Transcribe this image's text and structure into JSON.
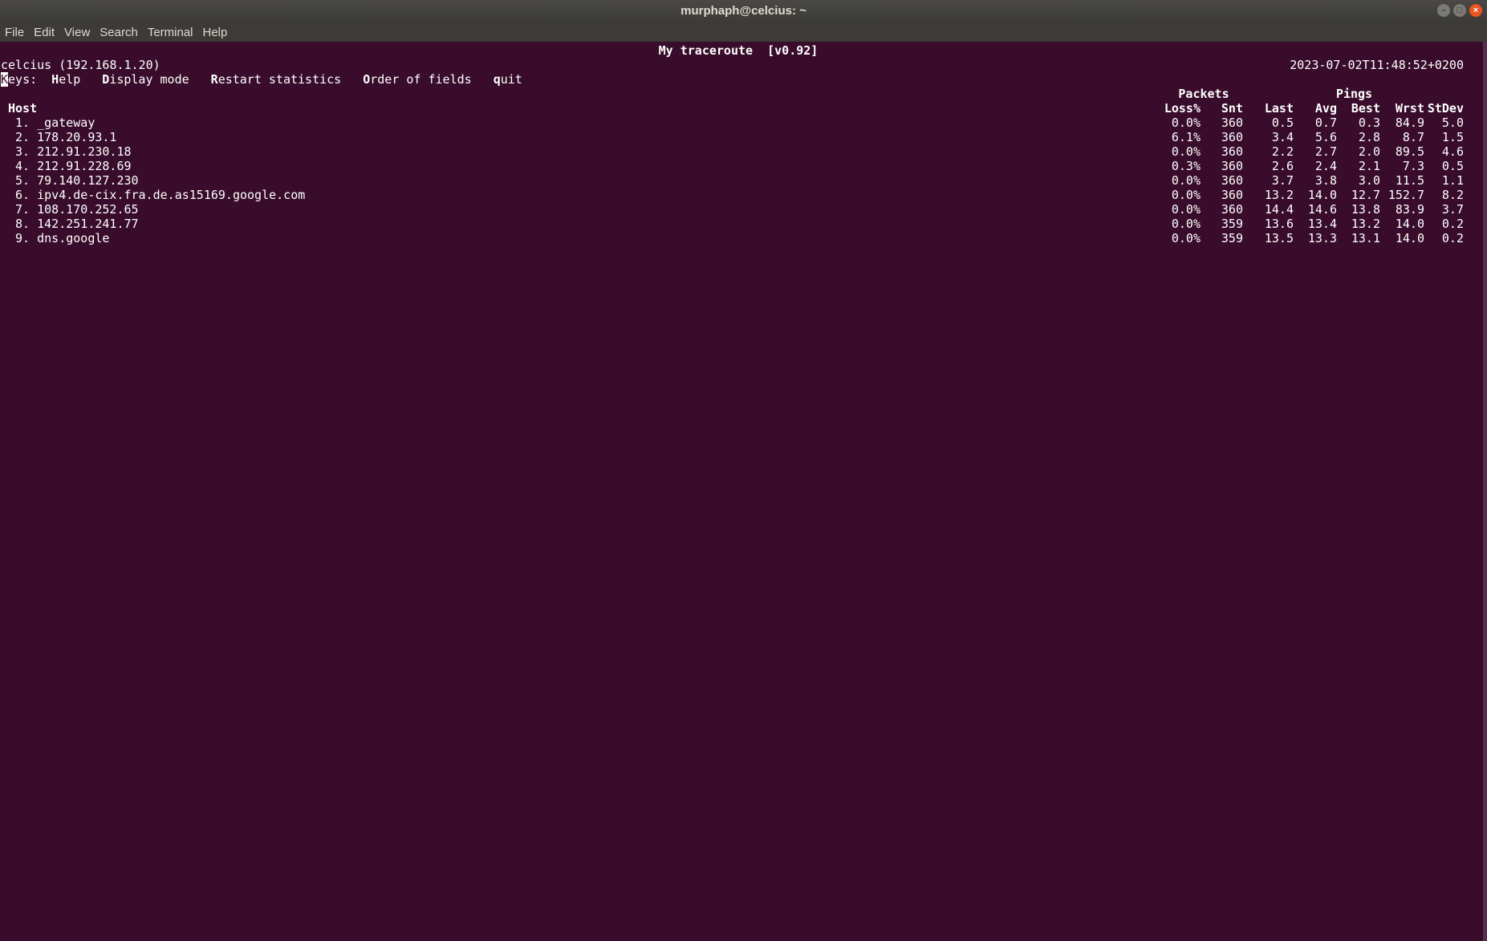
{
  "window": {
    "title": "murphaph@celcius: ~"
  },
  "menubar": {
    "items": [
      "File",
      "Edit",
      "View",
      "Search",
      "Terminal",
      "Help"
    ]
  },
  "mtr": {
    "title": "My traceroute  [v0.92]",
    "host_line": "celcius (192.168.1.20)",
    "timestamp": "2023-07-02T11:48:52+0200",
    "keys_cursor": "K",
    "keys_label_rest": "eys:",
    "keys": [
      {
        "hot": "H",
        "rest": "elp"
      },
      {
        "hot": "D",
        "rest": "isplay mode"
      },
      {
        "hot": "R",
        "rest": "estart statistics"
      },
      {
        "hot": "O",
        "rest": "rder of fields"
      },
      {
        "hot": "q",
        "rest": "uit"
      }
    ],
    "group_packets": "Packets",
    "group_pings": "Pings",
    "columns": {
      "host": "Host",
      "loss": "Loss%",
      "snt": "Snt",
      "last": "Last",
      "avg": "Avg",
      "best": "Best",
      "wrst": "Wrst",
      "stdev": "StDev"
    },
    "rows": [
      {
        "host": " 1. _gateway",
        "loss": "0.0%",
        "snt": "360",
        "last": "0.5",
        "avg": "0.7",
        "best": "0.3",
        "wrst": "84.9",
        "stdev": "5.0"
      },
      {
        "host": " 2. 178.20.93.1",
        "loss": "6.1%",
        "snt": "360",
        "last": "3.4",
        "avg": "5.6",
        "best": "2.8",
        "wrst": "8.7",
        "stdev": "1.5"
      },
      {
        "host": " 3. 212.91.230.18",
        "loss": "0.0%",
        "snt": "360",
        "last": "2.2",
        "avg": "2.7",
        "best": "2.0",
        "wrst": "89.5",
        "stdev": "4.6"
      },
      {
        "host": " 4. 212.91.228.69",
        "loss": "0.3%",
        "snt": "360",
        "last": "2.6",
        "avg": "2.4",
        "best": "2.1",
        "wrst": "7.3",
        "stdev": "0.5"
      },
      {
        "host": " 5. 79.140.127.230",
        "loss": "0.0%",
        "snt": "360",
        "last": "3.7",
        "avg": "3.8",
        "best": "3.0",
        "wrst": "11.5",
        "stdev": "1.1"
      },
      {
        "host": " 6. ipv4.de-cix.fra.de.as15169.google.com",
        "loss": "0.0%",
        "snt": "360",
        "last": "13.2",
        "avg": "14.0",
        "best": "12.7",
        "wrst": "152.7",
        "stdev": "8.2"
      },
      {
        "host": " 7. 108.170.252.65",
        "loss": "0.0%",
        "snt": "360",
        "last": "14.4",
        "avg": "14.6",
        "best": "13.8",
        "wrst": "83.9",
        "stdev": "3.7"
      },
      {
        "host": " 8. 142.251.241.77",
        "loss": "0.0%",
        "snt": "359",
        "last": "13.6",
        "avg": "13.4",
        "best": "13.2",
        "wrst": "14.0",
        "stdev": "0.2"
      },
      {
        "host": " 9. dns.google",
        "loss": "0.0%",
        "snt": "359",
        "last": "13.5",
        "avg": "13.3",
        "best": "13.1",
        "wrst": "14.0",
        "stdev": "0.2"
      }
    ]
  },
  "colors": {
    "terminal_bg": "#380c2a",
    "terminal_fg": "#ffffff",
    "titlebar_bg": "#3c3b37",
    "close_button": "#e95420"
  },
  "icons": {
    "minimize": "minimize-icon",
    "maximize": "maximize-icon",
    "close": "close-icon"
  }
}
